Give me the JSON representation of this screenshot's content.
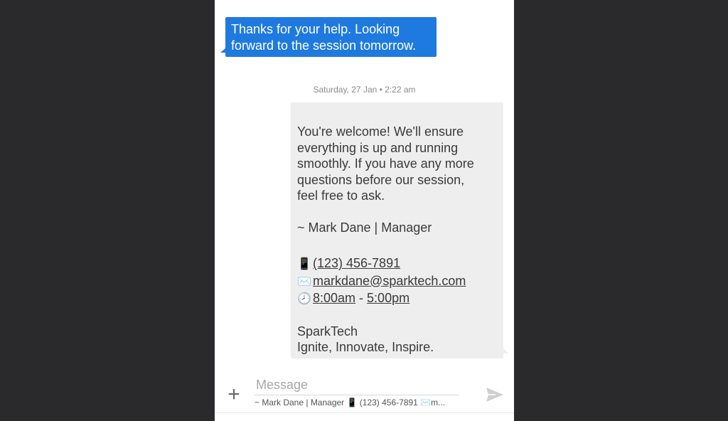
{
  "conversation": {
    "incoming": {
      "lines": [
        "Thanks for your help. Looking",
        "forward to the session tomorrow."
      ]
    },
    "timestamp": "Saturday, 27 Jan • 2:22 am",
    "outgoing": {
      "body_lines": [
        "You're welcome! We'll ensure",
        "everything is up and running",
        "smoothly. If you have any more",
        "questions before our session,",
        "feel free to ask."
      ],
      "signature_name": "~ Mark Dane | Manager",
      "phone": "(123) 456-7891",
      "email": "markdane@sparktech.com",
      "hours_start": "8:00am",
      "hours_separator": " - ",
      "hours_end": "5:00pm",
      "company": "SparkTech",
      "tagline": "Ignite, Innovate, Inspire.",
      "phone_icon": "📱",
      "email_icon": "✉️",
      "clock_icon": "🕗"
    }
  },
  "composer": {
    "placeholder": "Message",
    "signature_preview": "~ Mark Dane | Manager  📱 (123) 456-7891  ✉️m...",
    "add_icon": "+"
  },
  "colors": {
    "incoming_bubble": "#1f7ae0",
    "outgoing_bubble": "#eeeeee",
    "background": "#2a2a2c",
    "send_icon": "#cfcfcf"
  }
}
